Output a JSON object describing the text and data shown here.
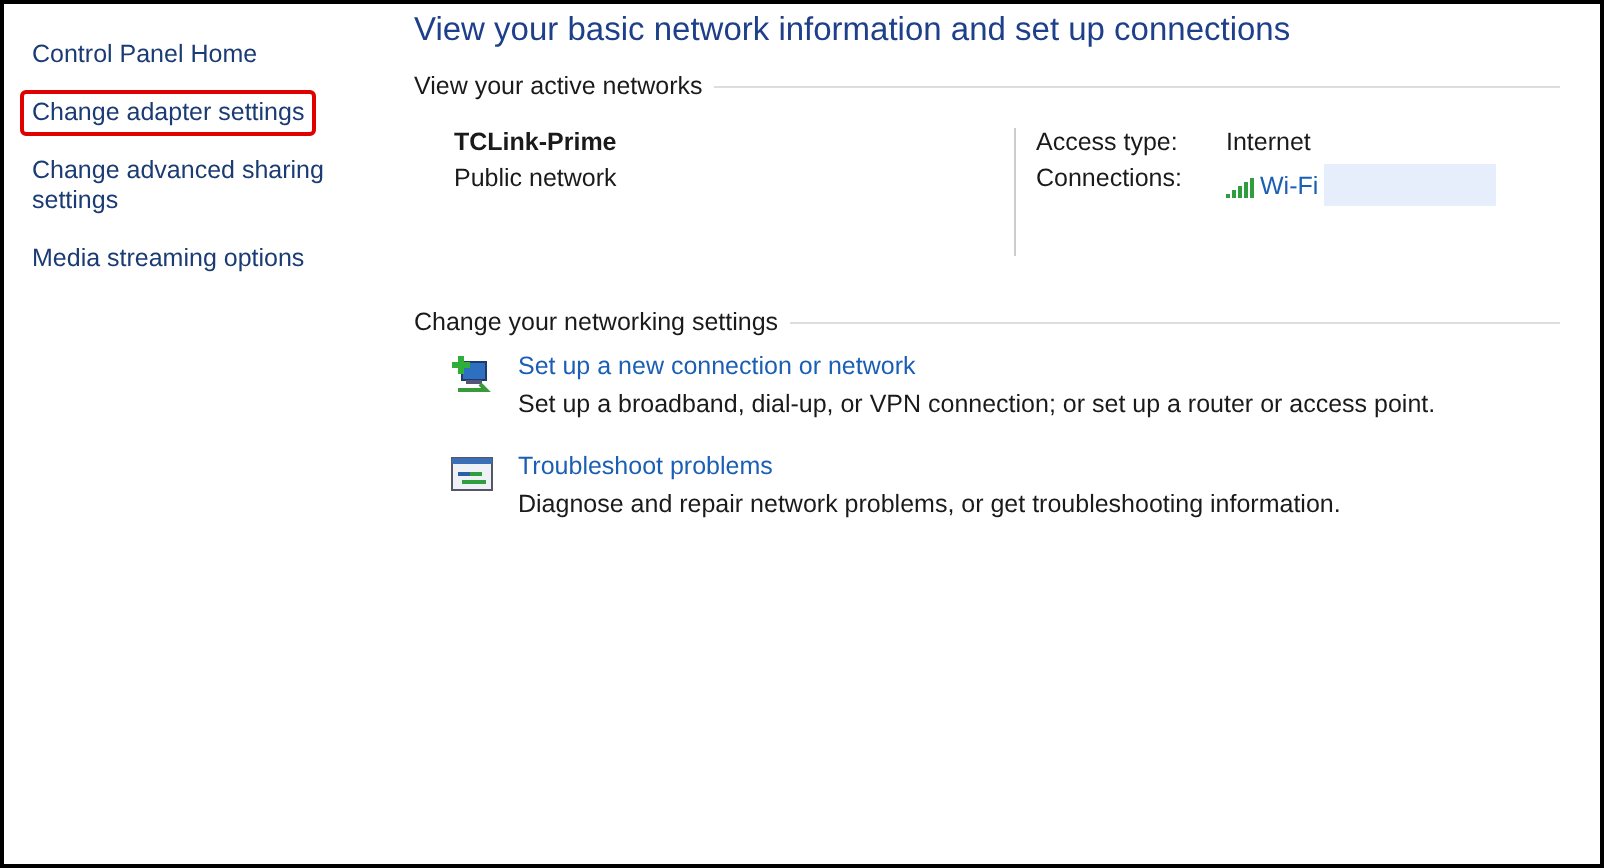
{
  "sidebar": {
    "items": [
      {
        "label": "Control Panel Home",
        "highlighted": false
      },
      {
        "label": "Change adapter settings",
        "highlighted": true
      },
      {
        "label": "Change advanced sharing settings",
        "highlighted": false
      },
      {
        "label": "Media streaming options",
        "highlighted": false
      }
    ]
  },
  "title": "View your basic network information and set up connections",
  "active_networks": {
    "heading": "View your active networks",
    "name": "TCLink-Prime",
    "category": "Public network",
    "access_type_label": "Access type:",
    "access_type": "Internet",
    "connections_label": "Connections:",
    "connection": "Wi-Fi",
    "connection_redacted": true
  },
  "settings": {
    "heading": "Change your networking settings",
    "tasks": [
      {
        "kind": "setup",
        "link": "Set up a new connection or network",
        "description": "Set up a broadband, dial-up, or VPN connection; or set up a router or access point."
      },
      {
        "kind": "troubleshoot",
        "link": "Troubleshoot problems",
        "description": "Diagnose and repair network problems, or get troubleshooting information."
      }
    ]
  }
}
